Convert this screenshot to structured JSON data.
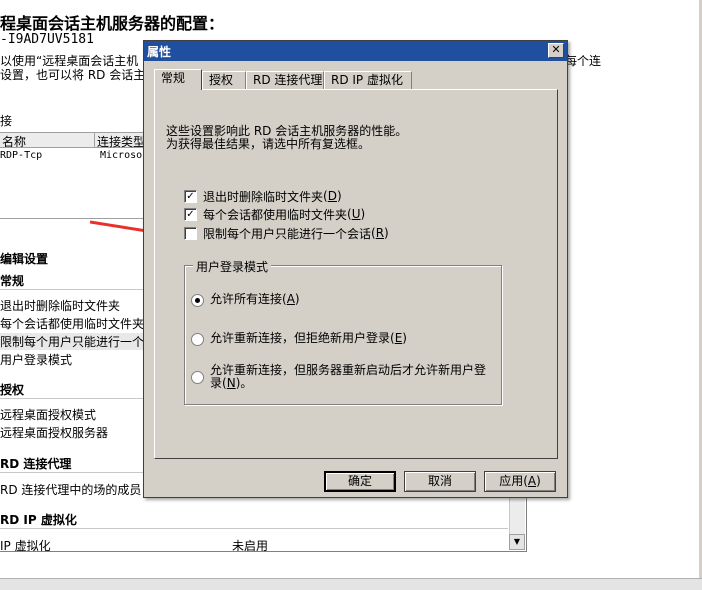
{
  "background": {
    "title": "程桌面会话主机服务器的配置：",
    "server_name": "-I9AD7UV5181",
    "desc_line1": "以使用“远程桌面会话主机",
    "desc_line1_right": "每个连",
    "desc_line2": "设置，也可以将 RD 会话主",
    "conn_marker": "接",
    "table": {
      "headers": [
        "名称",
        "连接类型"
      ],
      "row": {
        "name": "RDP-Tcp",
        "type": "Microso"
      }
    },
    "settings_title": "编辑设置",
    "groups": [
      {
        "label": "常规",
        "items": [
          "退出时删除临时文件夹",
          "每个会话都使用临时文件夹",
          "限制每个用户只能进行一个",
          "用户登录模式"
        ]
      },
      {
        "label": "授权",
        "items": [
          "远程桌面授权模式",
          "远程桌面授权服务器"
        ]
      },
      {
        "label": "RD 连接代理",
        "items": [
          "RD 连接代理中的场的成员"
        ]
      },
      {
        "label": "RD IP 虚拟化",
        "items": []
      }
    ],
    "vdisabled": {
      "label": "IP 虚拟化",
      "value": "未启用"
    }
  },
  "dialog": {
    "title": "属性",
    "close_symbol": "✕",
    "tabs": [
      "常规",
      "授权",
      "RD 连接代理",
      "RD IP 虚拟化"
    ],
    "intro_line1": "这些设置影响此 RD 会话主机服务器的性能。",
    "intro_line2": "为获得最佳结果，请选中所有复选框。",
    "checkboxes": [
      {
        "label": "退出时删除临时文件夹",
        "key": "D",
        "checked": true
      },
      {
        "label": "每个会话都使用临时文件夹",
        "key": "U",
        "checked": true
      },
      {
        "label": "限制每个用户只能进行一个会话",
        "key": "R",
        "checked": false
      }
    ],
    "login_mode": {
      "legend": "用户登录模式",
      "options": [
        {
          "line1": "允许所有连接",
          "key": "A",
          "selected": true
        },
        {
          "line1": "允许重新连接，但拒绝新用户登录",
          "key": "E",
          "selected": false
        },
        {
          "line1": "允许重新连接，但服务器重新启动后才允许新用户登",
          "line2": "录",
          "key": "N",
          "selected": false
        }
      ]
    },
    "buttons": {
      "ok": "确定",
      "cancel": "取消",
      "apply": "应用",
      "apply_key": "A"
    }
  }
}
